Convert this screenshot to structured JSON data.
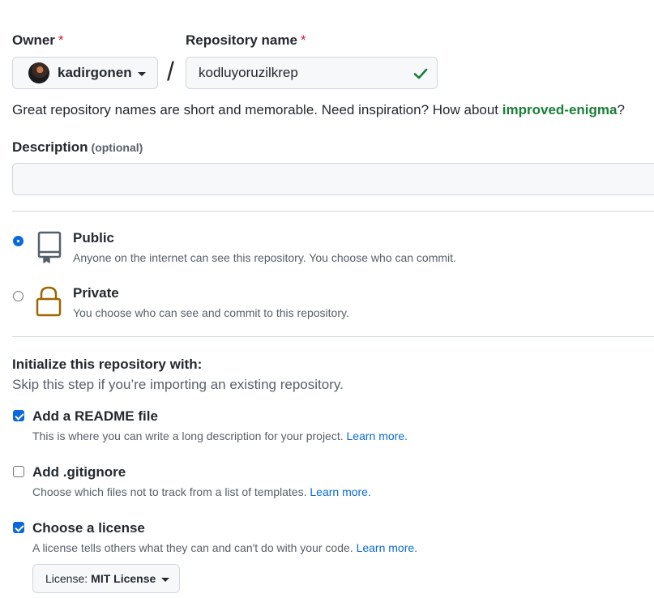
{
  "owner": {
    "label": "Owner",
    "required_mark": "*",
    "selected": "kadirgonen"
  },
  "repository": {
    "label": "Repository name",
    "required_mark": "*",
    "value": "kodluyoruzilkrep",
    "separator": "/",
    "valid": true
  },
  "name_hint": {
    "text": "Great repository names are short and memorable. Need inspiration? How about ",
    "suggestion": "improved-enigma",
    "suffix": "?"
  },
  "description": {
    "label": "Description",
    "optional": "(optional)",
    "value": ""
  },
  "visibility": {
    "options": [
      {
        "title": "Public",
        "desc": "Anyone on the internet can see this repository. You choose who can commit.",
        "selected": true,
        "icon": "repo-icon"
      },
      {
        "title": "Private",
        "desc": "You choose who can see and commit to this repository.",
        "selected": false,
        "icon": "lock-icon"
      }
    ]
  },
  "init": {
    "heading": "Initialize this repository with:",
    "subheading": "Skip this step if you’re importing an existing repository.",
    "items": [
      {
        "title": "Add a README file",
        "desc": "This is where you can write a long description for your project.",
        "link": "Learn more.",
        "checked": true
      },
      {
        "title": "Add .gitignore",
        "desc": "Choose which files not to track from a list of templates.",
        "link": "Learn more.",
        "checked": false
      },
      {
        "title": "Choose a license",
        "desc": "A license tells others what they can and can't do with your code.",
        "link": "Learn more.",
        "checked": true
      }
    ],
    "license": {
      "prefix": "License:",
      "value": "MIT License"
    }
  },
  "colors": {
    "accent": "#0969da",
    "success": "#1a7f37",
    "required": "#cf222e",
    "lock": "#9a6700"
  }
}
